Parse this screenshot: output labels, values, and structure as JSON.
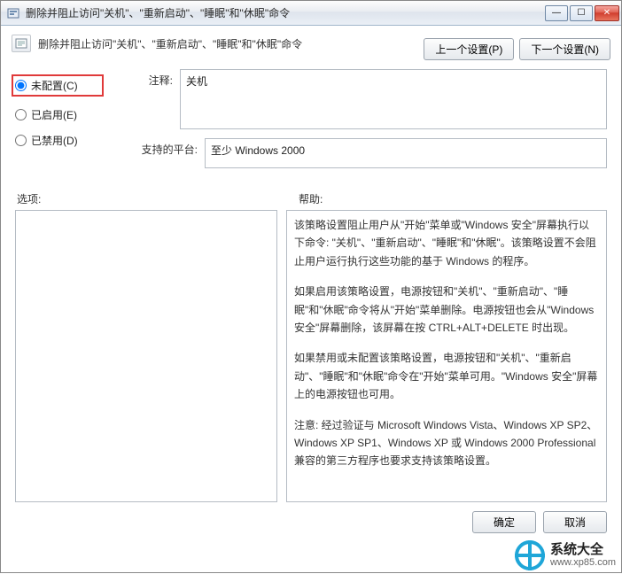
{
  "titlebar": {
    "icon_name": "policy-icon",
    "title": "删除并阻止访问\"关机\"、\"重新启动\"、\"睡眠\"和\"休眠\"命令"
  },
  "subheader": {
    "icon_name": "document-icon",
    "text": "删除并阻止访问\"关机\"、\"重新启动\"、\"睡眠\"和\"休眠\"命令"
  },
  "nav": {
    "prev": "上一个设置(P)",
    "next": "下一个设置(N)"
  },
  "radios": {
    "not_configured": "未配置(C)",
    "enabled": "已启用(E)",
    "disabled": "已禁用(D)",
    "selected": "not_configured"
  },
  "fields": {
    "comment_label": "注释:",
    "comment_value": "关机",
    "platform_label": "支持的平台:",
    "platform_value": "至少 Windows 2000"
  },
  "sections": {
    "options": "选项:",
    "help": "帮助:"
  },
  "help": {
    "p1": "该策略设置阻止用户从\"开始\"菜单或\"Windows 安全\"屏幕执行以下命令: \"关机\"、\"重新启动\"、\"睡眠\"和\"休眠\"。该策略设置不会阻止用户运行执行这些功能的基于 Windows 的程序。",
    "p2": "如果启用该策略设置，电源按钮和\"关机\"、\"重新启动\"、\"睡眠\"和\"休眠\"命令将从\"开始\"菜单删除。电源按钮也会从\"Windows 安全\"屏幕删除，该屏幕在按 CTRL+ALT+DELETE 时出现。",
    "p3": "如果禁用或未配置该策略设置，电源按钮和\"关机\"、\"重新启动\"、\"睡眠\"和\"休眠\"命令在\"开始\"菜单可用。\"Windows 安全\"屏幕上的电源按钮也可用。",
    "p4": "注意: 经过验证与 Microsoft Windows Vista、Windows XP SP2、Windows XP SP1、Windows XP 或 Windows 2000 Professional 兼容的第三方程序也要求支持该策略设置。"
  },
  "footer": {
    "ok": "确定",
    "cancel": "取消"
  },
  "watermark": {
    "line1": "系统大全",
    "line2": "www.xp85.com"
  },
  "win_buttons": {
    "min_glyph": "—",
    "max_glyph": "☐",
    "close_glyph": "✕"
  }
}
